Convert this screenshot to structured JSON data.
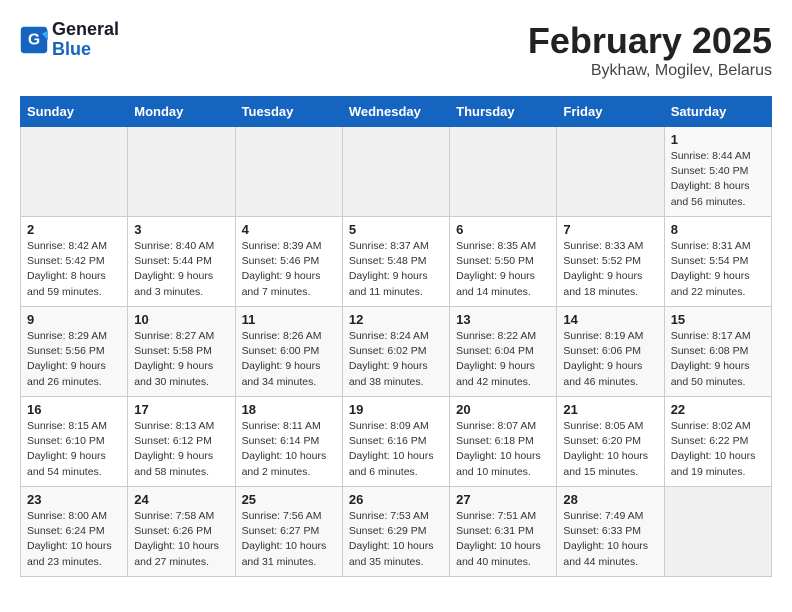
{
  "logo": {
    "line1": "General",
    "line2": "Blue"
  },
  "title": "February 2025",
  "location": "Bykhaw, Mogilev, Belarus",
  "days_of_week": [
    "Sunday",
    "Monday",
    "Tuesday",
    "Wednesday",
    "Thursday",
    "Friday",
    "Saturday"
  ],
  "weeks": [
    [
      {
        "day": "",
        "info": ""
      },
      {
        "day": "",
        "info": ""
      },
      {
        "day": "",
        "info": ""
      },
      {
        "day": "",
        "info": ""
      },
      {
        "day": "",
        "info": ""
      },
      {
        "day": "",
        "info": ""
      },
      {
        "day": "1",
        "info": "Sunrise: 8:44 AM\nSunset: 5:40 PM\nDaylight: 8 hours and 56 minutes."
      }
    ],
    [
      {
        "day": "2",
        "info": "Sunrise: 8:42 AM\nSunset: 5:42 PM\nDaylight: 8 hours and 59 minutes."
      },
      {
        "day": "3",
        "info": "Sunrise: 8:40 AM\nSunset: 5:44 PM\nDaylight: 9 hours and 3 minutes."
      },
      {
        "day": "4",
        "info": "Sunrise: 8:39 AM\nSunset: 5:46 PM\nDaylight: 9 hours and 7 minutes."
      },
      {
        "day": "5",
        "info": "Sunrise: 8:37 AM\nSunset: 5:48 PM\nDaylight: 9 hours and 11 minutes."
      },
      {
        "day": "6",
        "info": "Sunrise: 8:35 AM\nSunset: 5:50 PM\nDaylight: 9 hours and 14 minutes."
      },
      {
        "day": "7",
        "info": "Sunrise: 8:33 AM\nSunset: 5:52 PM\nDaylight: 9 hours and 18 minutes."
      },
      {
        "day": "8",
        "info": "Sunrise: 8:31 AM\nSunset: 5:54 PM\nDaylight: 9 hours and 22 minutes."
      }
    ],
    [
      {
        "day": "9",
        "info": "Sunrise: 8:29 AM\nSunset: 5:56 PM\nDaylight: 9 hours and 26 minutes."
      },
      {
        "day": "10",
        "info": "Sunrise: 8:27 AM\nSunset: 5:58 PM\nDaylight: 9 hours and 30 minutes."
      },
      {
        "day": "11",
        "info": "Sunrise: 8:26 AM\nSunset: 6:00 PM\nDaylight: 9 hours and 34 minutes."
      },
      {
        "day": "12",
        "info": "Sunrise: 8:24 AM\nSunset: 6:02 PM\nDaylight: 9 hours and 38 minutes."
      },
      {
        "day": "13",
        "info": "Sunrise: 8:22 AM\nSunset: 6:04 PM\nDaylight: 9 hours and 42 minutes."
      },
      {
        "day": "14",
        "info": "Sunrise: 8:19 AM\nSunset: 6:06 PM\nDaylight: 9 hours and 46 minutes."
      },
      {
        "day": "15",
        "info": "Sunrise: 8:17 AM\nSunset: 6:08 PM\nDaylight: 9 hours and 50 minutes."
      }
    ],
    [
      {
        "day": "16",
        "info": "Sunrise: 8:15 AM\nSunset: 6:10 PM\nDaylight: 9 hours and 54 minutes."
      },
      {
        "day": "17",
        "info": "Sunrise: 8:13 AM\nSunset: 6:12 PM\nDaylight: 9 hours and 58 minutes."
      },
      {
        "day": "18",
        "info": "Sunrise: 8:11 AM\nSunset: 6:14 PM\nDaylight: 10 hours and 2 minutes."
      },
      {
        "day": "19",
        "info": "Sunrise: 8:09 AM\nSunset: 6:16 PM\nDaylight: 10 hours and 6 minutes."
      },
      {
        "day": "20",
        "info": "Sunrise: 8:07 AM\nSunset: 6:18 PM\nDaylight: 10 hours and 10 minutes."
      },
      {
        "day": "21",
        "info": "Sunrise: 8:05 AM\nSunset: 6:20 PM\nDaylight: 10 hours and 15 minutes."
      },
      {
        "day": "22",
        "info": "Sunrise: 8:02 AM\nSunset: 6:22 PM\nDaylight: 10 hours and 19 minutes."
      }
    ],
    [
      {
        "day": "23",
        "info": "Sunrise: 8:00 AM\nSunset: 6:24 PM\nDaylight: 10 hours and 23 minutes."
      },
      {
        "day": "24",
        "info": "Sunrise: 7:58 AM\nSunset: 6:26 PM\nDaylight: 10 hours and 27 minutes."
      },
      {
        "day": "25",
        "info": "Sunrise: 7:56 AM\nSunset: 6:27 PM\nDaylight: 10 hours and 31 minutes."
      },
      {
        "day": "26",
        "info": "Sunrise: 7:53 AM\nSunset: 6:29 PM\nDaylight: 10 hours and 35 minutes."
      },
      {
        "day": "27",
        "info": "Sunrise: 7:51 AM\nSunset: 6:31 PM\nDaylight: 10 hours and 40 minutes."
      },
      {
        "day": "28",
        "info": "Sunrise: 7:49 AM\nSunset: 6:33 PM\nDaylight: 10 hours and 44 minutes."
      },
      {
        "day": "",
        "info": ""
      }
    ]
  ]
}
